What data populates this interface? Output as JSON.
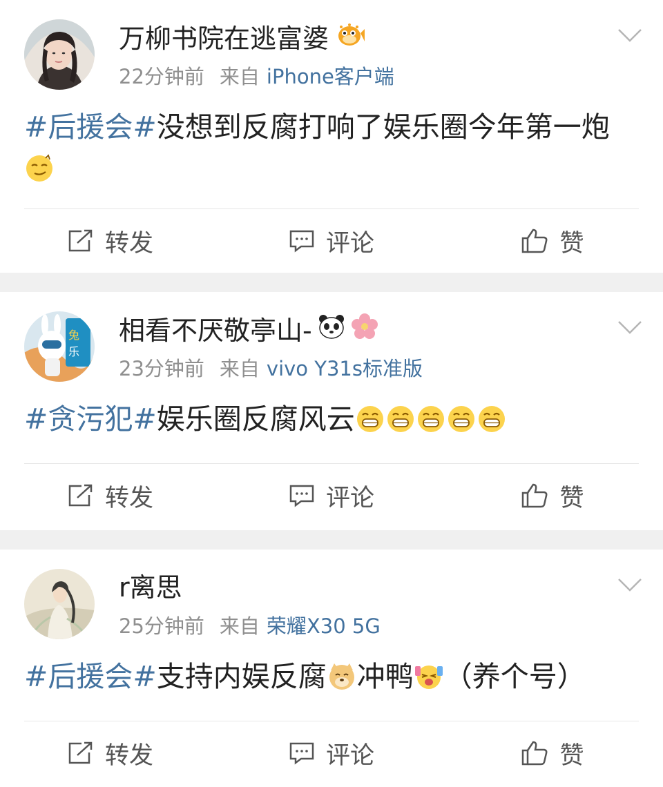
{
  "posts": [
    {
      "name": "万柳书院在逃富婆",
      "time": "22分钟前",
      "source_prefix": "来自",
      "device": "iPhone客户端",
      "topic": "#后援会#",
      "text_1": "没想到反腐打响了娱乐圈今年第一炮",
      "text_2": "",
      "text_3": ""
    },
    {
      "name": "相看不厌敬亭山-",
      "time": "23分钟前",
      "source_prefix": "来自",
      "device": "vivo Y31s标准版",
      "topic": "#贪污犯#",
      "text_1": "娱乐圈反腐风云",
      "text_2": "",
      "text_3": ""
    },
    {
      "name": "r离思",
      "time": "25分钟前",
      "source_prefix": "来自",
      "device": "荣耀X30 5G",
      "topic": "#后援会#",
      "text_1": "支持内娱反腐",
      "text_2": "冲鸭",
      "text_3": "（养个号）"
    }
  ],
  "actions": {
    "repost": "转发",
    "comment": "评论",
    "like": "赞"
  },
  "colors": {
    "link": "#43729f",
    "meta": "#8f8f8f",
    "separator": "#f0f0f0"
  },
  "icons": [
    "chevron-down-icon",
    "repost-icon",
    "comment-icon",
    "like-icon",
    "pufferfish-badge-icon",
    "panda-badge-icon",
    "blossom-badge-icon"
  ]
}
